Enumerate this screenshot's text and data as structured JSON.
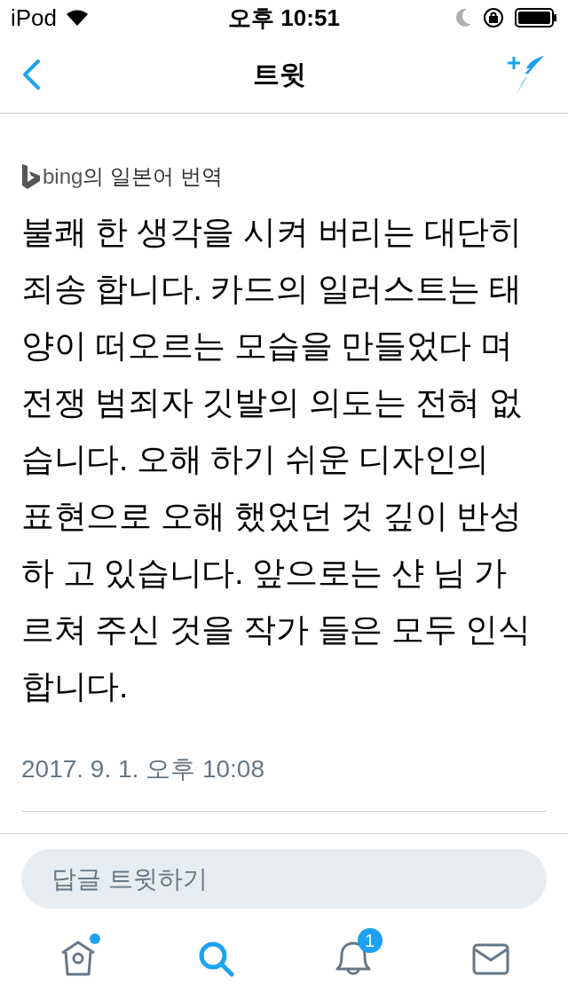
{
  "status_bar": {
    "device": "iPod",
    "time": "오후 10:51"
  },
  "nav": {
    "title": "트윗"
  },
  "translation": {
    "provider": "bing",
    "label": "의 일본어 번역"
  },
  "tweet": {
    "lines": [
      "불쾌 한 생각을 시켜 버리는 대단히",
      "죄송 합니다. 카드의 일러스트는 태",
      "양이 떠오르는 모습을 만들었다 며",
      "전쟁 범죄자 깃발의 의도는 전혀 없",
      "습니다. 오해 하기 쉬운 디자인의",
      "표현으로 오해 했었던 것 깊이 반성",
      "하 고 있습니다. 앞으로는 샨 님 가",
      "르쳐 주신 것을 작가 들은 모두 인식",
      "합니다."
    ],
    "timestamp": "2017. 9. 1. 오후 10:08"
  },
  "reply": {
    "placeholder": "답글 트윗하기"
  },
  "tabs": [
    {
      "kind": "home",
      "selected": false,
      "dot": true
    },
    {
      "kind": "search",
      "selected": true,
      "dot": false
    },
    {
      "kind": "notifications",
      "selected": false,
      "badge": "1"
    },
    {
      "kind": "messages",
      "selected": false,
      "dot": false
    }
  ]
}
